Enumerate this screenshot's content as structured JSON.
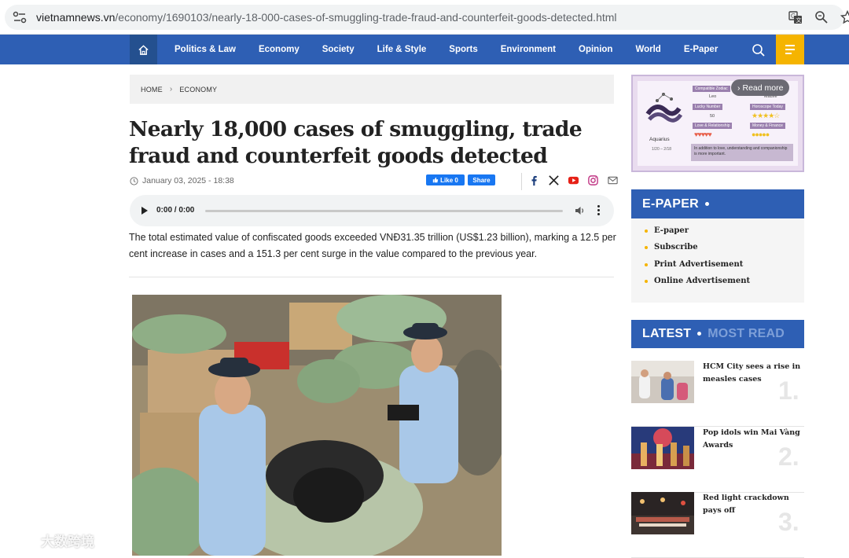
{
  "browser": {
    "url_domain": "vietnamnews.vn",
    "url_path": "/economy/1690103/nearly-18-000-cases-of-smuggling-trade-fraud-and-counterfeit-goods-detected.html",
    "icons": [
      "site-info-icon",
      "translate-icon",
      "zoom-icon",
      "bookmark-star-icon"
    ]
  },
  "nav": {
    "items": [
      "Politics & Law",
      "Economy",
      "Society",
      "Life & Style",
      "Sports",
      "Environment",
      "Opinion",
      "World",
      "E-Paper"
    ],
    "accent": "#2e5fb4",
    "menu_color": "#f5b400"
  },
  "breadcrumb": {
    "home": "HOME",
    "section": "ECONOMY"
  },
  "article": {
    "headline": "Nearly 18,000 cases of smuggling, trade fraud and counterfeit goods detected",
    "date": "January 03, 2025 - 18:38",
    "like_label": "Like 0",
    "share_label": "Share",
    "summary": "The total estimated value of confiscated goods exceeded VNĐ31.35 trillion (US$1.23 billion), marking a 12.5 per cent increase in cases and a 151.3 per cent surge in the value compared to the previous year.",
    "audio_time": "0:00 / 0:00"
  },
  "ad": {
    "read_more": "Read more",
    "zodiac": "Aquarius",
    "dates": "1/20 – 2/18",
    "compatible_label": "Compatible Zodiac",
    "compatible_value": "Leo",
    "color_label": "Mauve",
    "lucky_label": "Lucky Number",
    "lucky_value": "50",
    "horoscope_label": "Horoscope Today",
    "love_label": "Love & Relationship",
    "money_label": "Money & Finance",
    "advice": "In addition to love, understanding and companionship is more important."
  },
  "epaper": {
    "title": "E-PAPER",
    "items": [
      "E-paper",
      "Subscribe",
      "Print Advertisement",
      "Online Advertisement"
    ]
  },
  "latest": {
    "tab_active": "LATEST",
    "tab_inactive": "MOST READ",
    "items": [
      {
        "title": "HCM City sees a rise in measles cases",
        "num": "1."
      },
      {
        "title": "Pop idols win Mai Vàng Awards",
        "num": "2."
      },
      {
        "title": "Red light crackdown pays off",
        "num": "3."
      }
    ]
  },
  "watermark": "大数跨境"
}
